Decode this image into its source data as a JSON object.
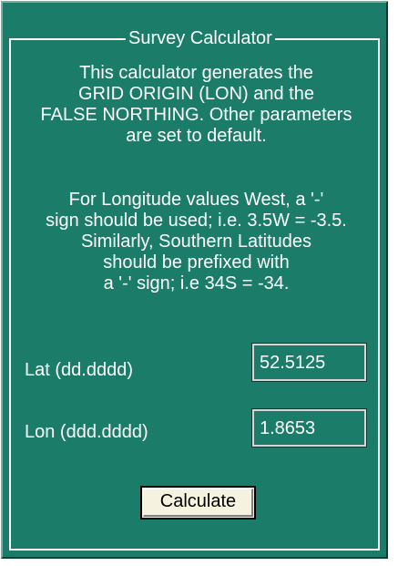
{
  "group": {
    "title": "Survey Calculator"
  },
  "intro": {
    "lines": [
      "This calculator generates the",
      "GRID ORIGIN (LON) and the",
      "FALSE NORTHING.  Other parameters",
      "are set to default."
    ]
  },
  "instructions": {
    "lines": [
      "For Longitude values West, a '-'",
      "sign should be used; i.e. 3.5W = -3.5.",
      "Similarly, Southern Latitudes",
      "should be prefixed with",
      "a '-' sign; i.e 34S = -34."
    ]
  },
  "fields": {
    "lat_label": "Lat (dd.dddd)",
    "lat_value": "52.5125",
    "lon_label": "Lon (ddd.dddd)",
    "lon_value": "1.8653"
  },
  "actions": {
    "calculate_label": "Calculate"
  },
  "colors": {
    "background": "#1b7c6a",
    "text": "#ffffff",
    "button_face": "#f5f2e0"
  }
}
